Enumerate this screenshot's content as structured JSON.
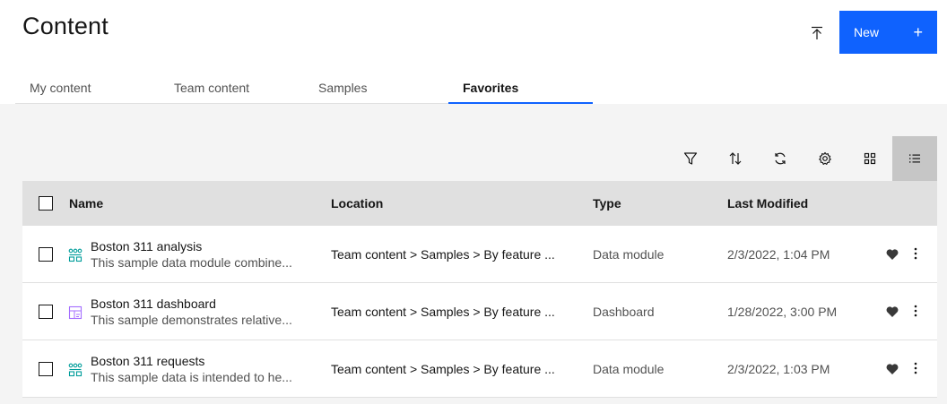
{
  "header": {
    "title": "Content",
    "upload_icon": "upload-icon",
    "new_label": "New",
    "new_plus": "+"
  },
  "tabs": [
    {
      "label": "My content",
      "active": false
    },
    {
      "label": "Team content",
      "active": false
    },
    {
      "label": "Samples",
      "active": false
    },
    {
      "label": "Favorites",
      "active": true
    }
  ],
  "toolbar": {
    "icons": [
      "filter-icon",
      "sort-icon",
      "refresh-icon",
      "settings-icon",
      "grid-view-icon",
      "list-view-icon"
    ],
    "active": "list-view-icon"
  },
  "table": {
    "columns": {
      "name": "Name",
      "location": "Location",
      "type": "Type",
      "modified": "Last Modified"
    },
    "rows": [
      {
        "name": "Boston 311 analysis",
        "description": "This sample data module combine...",
        "icon": "data-module-icon",
        "location": "Team content > Samples > By feature ...",
        "type": "Data module",
        "modified": "2/3/2022, 1:04 PM"
      },
      {
        "name": "Boston 311 dashboard",
        "description": "This sample demonstrates relative...",
        "icon": "dashboard-icon",
        "location": "Team content > Samples > By feature ...",
        "type": "Dashboard",
        "modified": "1/28/2022, 3:00 PM"
      },
      {
        "name": "Boston 311 requests",
        "description": "This sample data is intended to he...",
        "icon": "data-module-icon",
        "location": "Team content > Samples > By feature ...",
        "type": "Data module",
        "modified": "2/3/2022, 1:03 PM"
      }
    ]
  },
  "colors": {
    "primary": "#0f62fe",
    "data_module": "#009d9a",
    "dashboard": "#a56eff"
  }
}
